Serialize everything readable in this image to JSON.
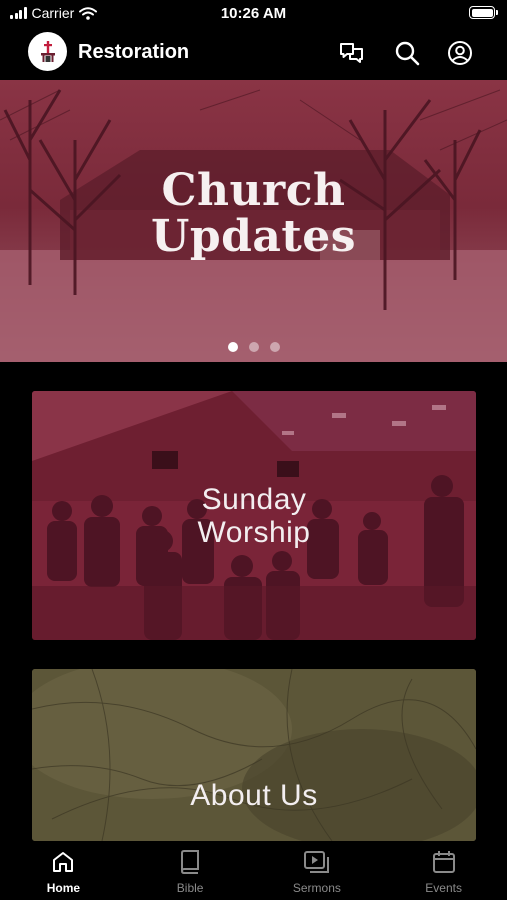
{
  "status_bar": {
    "carrier": "Carrier",
    "time": "10:26 AM"
  },
  "header": {
    "app_title": "Restoration",
    "icons": [
      "chat-icon",
      "search-icon",
      "profile-icon"
    ]
  },
  "hero": {
    "title_line1": "Church",
    "title_line2": "Updates",
    "carousel": {
      "total": 3,
      "active_index": 0
    }
  },
  "cards": [
    {
      "title_line1": "Sunday",
      "title_line2": "Worship"
    },
    {
      "title": "About Us"
    }
  ],
  "tabs": [
    {
      "label": "Home",
      "icon": "home-icon",
      "active": true
    },
    {
      "label": "Bible",
      "icon": "book-icon",
      "active": false
    },
    {
      "label": "Sermons",
      "icon": "video-icon",
      "active": false
    },
    {
      "label": "Events",
      "icon": "calendar-icon",
      "active": false
    }
  ],
  "colors": {
    "background": "#000000",
    "hero_tint": "#7a2a3a",
    "worship_tint": "#7a2438",
    "about_tint": "#5a5438",
    "tab_inactive": "#8a8a8a",
    "tab_active": "#ffffff"
  }
}
